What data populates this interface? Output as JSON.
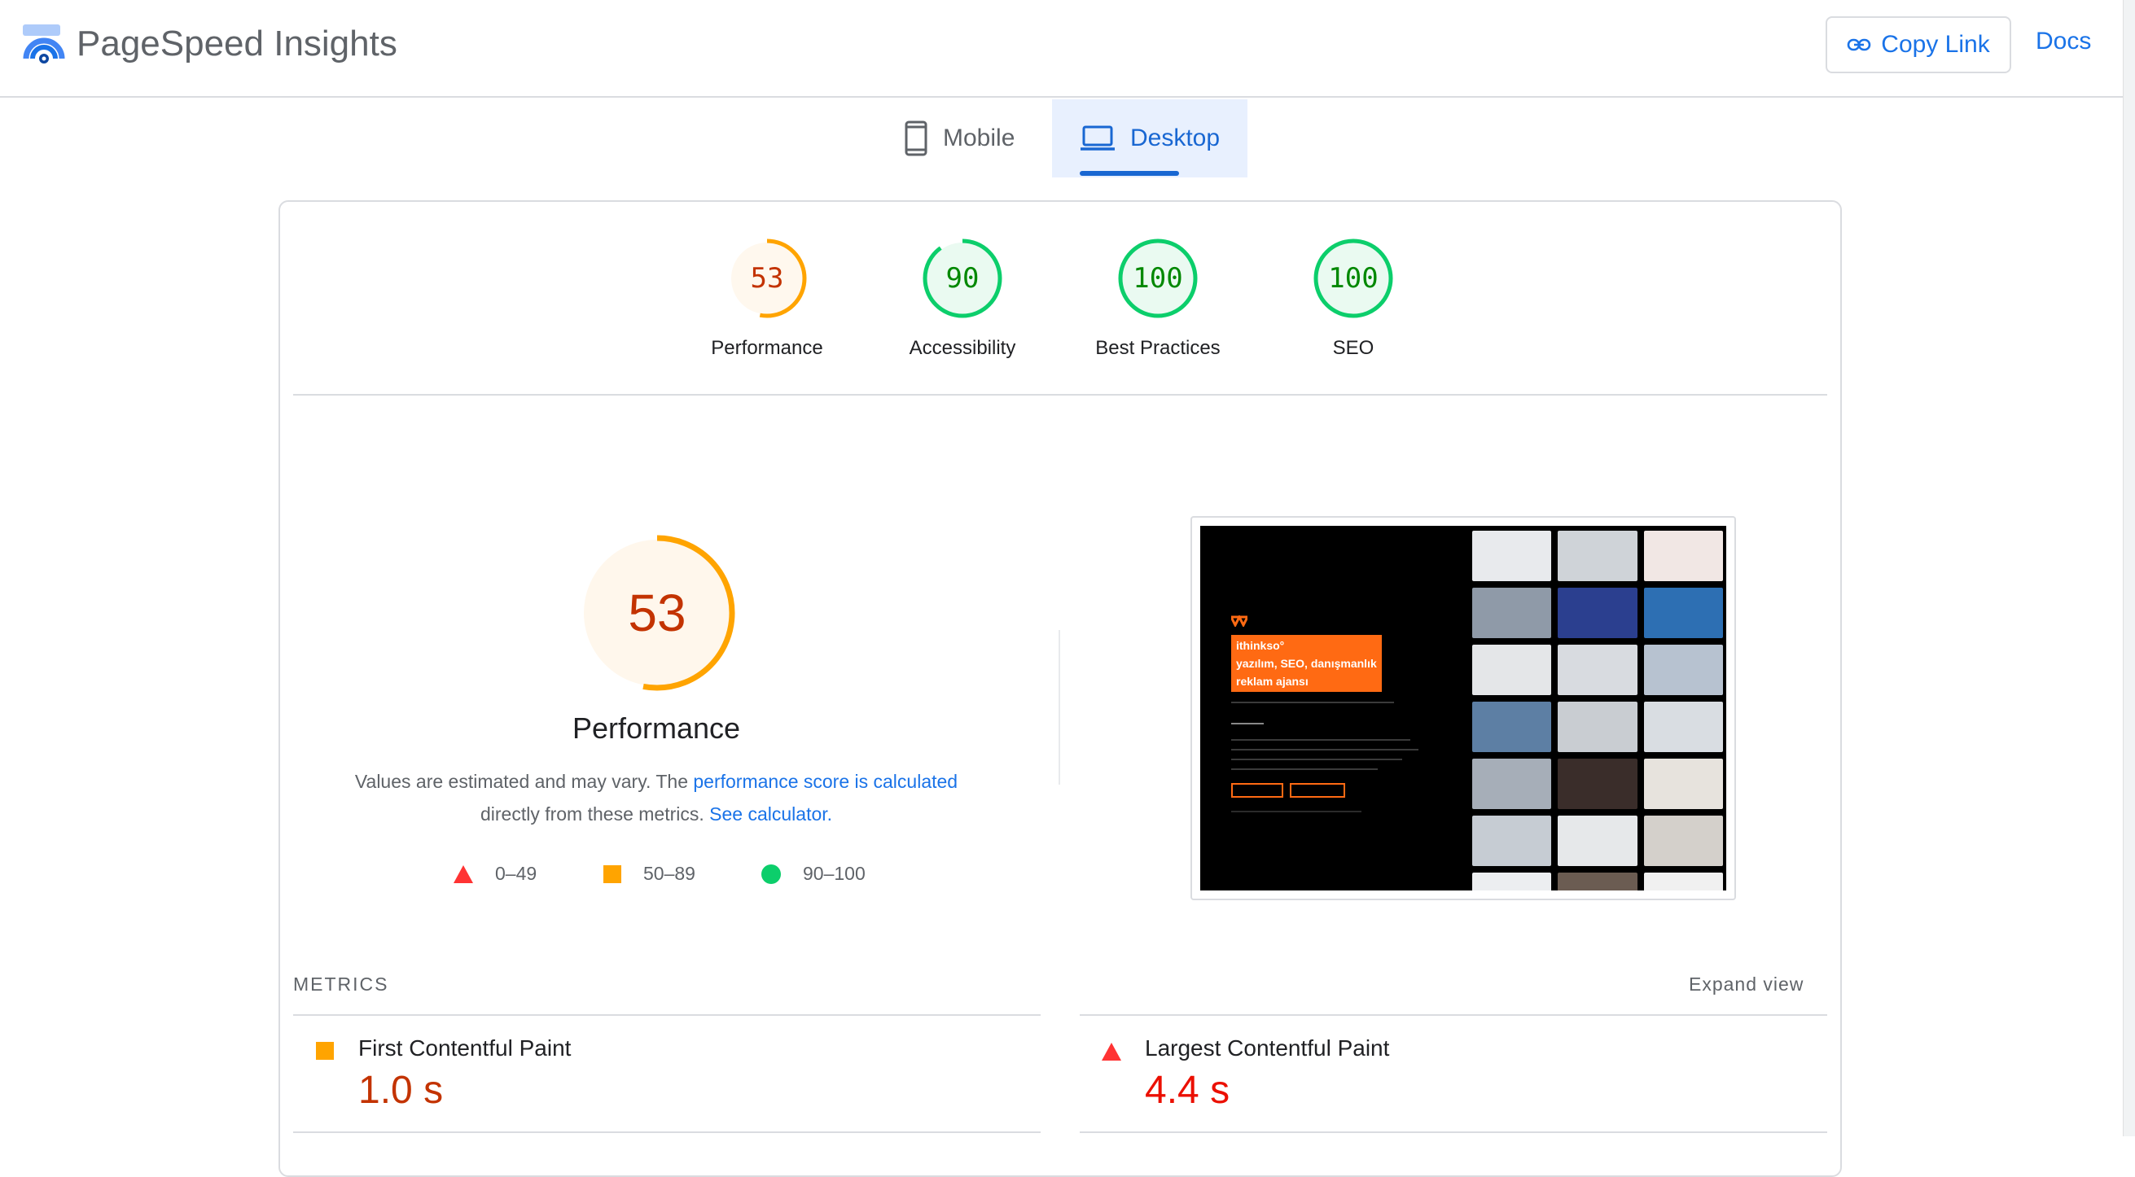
{
  "header": {
    "app_title": "PageSpeed Insights",
    "copy_link_label": "Copy Link",
    "docs_label": "Docs"
  },
  "tabs": [
    {
      "label": "Mobile",
      "icon": "phone-icon",
      "selected": false
    },
    {
      "label": "Desktop",
      "icon": "laptop-icon",
      "selected": true
    }
  ],
  "categories": [
    {
      "score": "53",
      "label": "Performance",
      "level": "average"
    },
    {
      "score": "90",
      "label": "Accessibility",
      "level": "pass"
    },
    {
      "score": "100",
      "label": "Best Practices",
      "level": "pass"
    },
    {
      "score": "100",
      "label": "SEO",
      "level": "pass"
    }
  ],
  "performance": {
    "score": "53",
    "title": "Performance",
    "desc_prefix": "Values are estimated and may vary. The ",
    "desc_link1": "performance score is calculated",
    "desc_mid": " directly from these metrics. ",
    "desc_link2": "See calculator.",
    "legend": [
      {
        "range": "0–49",
        "icon": "fail-triangle-icon"
      },
      {
        "range": "50–89",
        "icon": "average-square-icon"
      },
      {
        "range": "90–100",
        "icon": "pass-circle-icon"
      }
    ]
  },
  "screenshot": {
    "headline_line1": "ithinkso°",
    "headline_line2": "yazılım, SEO, danışmanlık",
    "headline_line3": "reklam ajansı"
  },
  "metrics": {
    "section_label": "METRICS",
    "expand_label": "Expand view",
    "items": [
      {
        "name": "First Contentful Paint",
        "value": "1.0 s",
        "level": "average"
      },
      {
        "name": "Largest Contentful Paint",
        "value": "4.4 s",
        "level": "fail"
      }
    ]
  },
  "colors": {
    "fail": "#ff3333",
    "average": "#ffa400",
    "pass": "#0cce6b",
    "fail_text": "#c33300",
    "average_text": "#c33300",
    "pass_text": "#008800",
    "link": "#1a73e8"
  }
}
